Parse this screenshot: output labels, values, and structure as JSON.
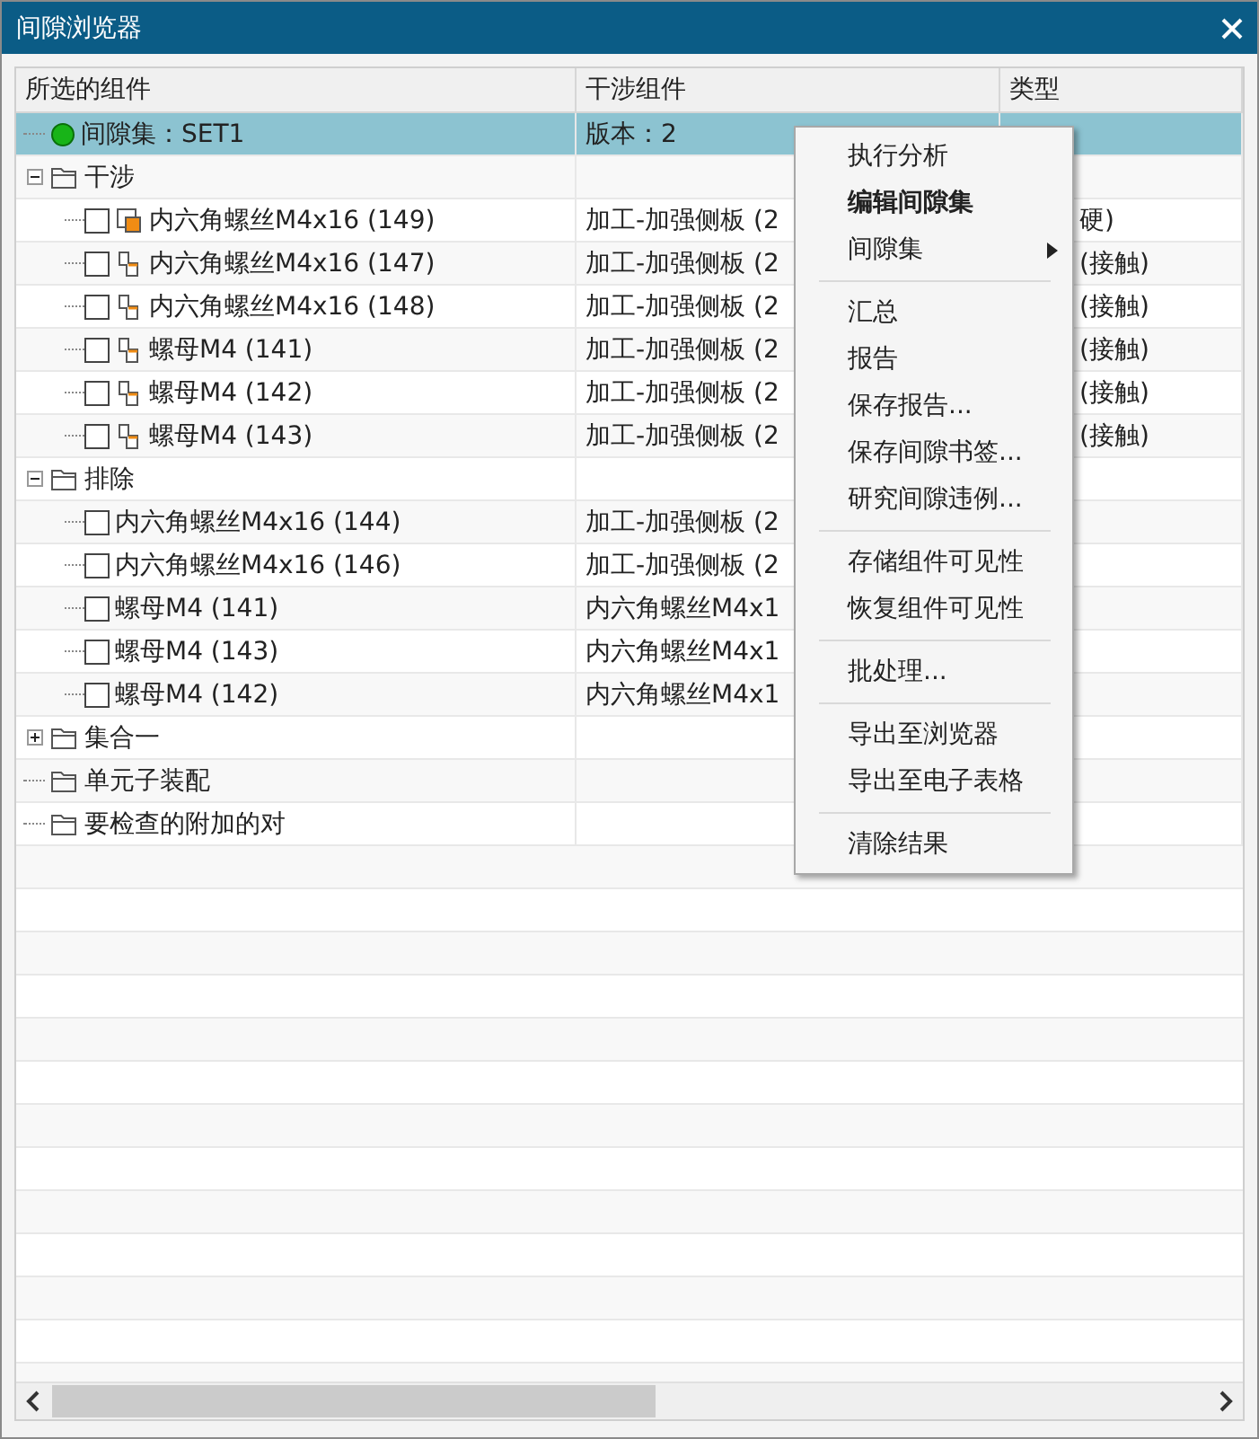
{
  "window": {
    "title": "间隙浏览器"
  },
  "columns": [
    "所选的组件",
    "干涉组件",
    "类型"
  ],
  "set": {
    "label": "间隙集：SET1",
    "interference": "版本：2",
    "selected": true
  },
  "groups": [
    {
      "label": "干涉",
      "expanded": true,
      "items": [
        {
          "label": "内六角螺丝M4x16 (149)",
          "kind": "part-active",
          "checked": false,
          "interference": "加工-加强侧板 (2",
          "type": "硬)"
        },
        {
          "label": "内六角螺丝M4x16 (147)",
          "kind": "part",
          "checked": false,
          "interference": "加工-加强侧板 (2",
          "type": "(接触)"
        },
        {
          "label": "内六角螺丝M4x16 (148)",
          "kind": "part",
          "checked": false,
          "interference": "加工-加强侧板 (2",
          "type": "(接触)"
        },
        {
          "label": "螺母M4 (141)",
          "kind": "part",
          "checked": false,
          "interference": "加工-加强侧板 (2",
          "type": "(接触)"
        },
        {
          "label": "螺母M4 (142)",
          "kind": "part",
          "checked": false,
          "interference": "加工-加强侧板 (2",
          "type": "(接触)"
        },
        {
          "label": "螺母M4 (143)",
          "kind": "part",
          "checked": false,
          "interference": "加工-加强侧板 (2",
          "type": "(接触)"
        }
      ]
    },
    {
      "label": "排除",
      "expanded": true,
      "items": [
        {
          "label": "内六角螺丝M4x16 (144)",
          "kind": "plain",
          "checked": false,
          "interference": "加工-加强侧板 (2"
        },
        {
          "label": "内六角螺丝M4x16 (146)",
          "kind": "plain",
          "checked": false,
          "interference": "加工-加强侧板 (2"
        },
        {
          "label": "螺母M4 (141)",
          "kind": "plain",
          "checked": false,
          "interference": "内六角螺丝M4x1"
        },
        {
          "label": "螺母M4 (143)",
          "kind": "plain",
          "checked": false,
          "interference": "内六角螺丝M4x1"
        },
        {
          "label": "螺母M4 (142)",
          "kind": "plain",
          "checked": false,
          "interference": "内六角螺丝M4x1"
        }
      ]
    },
    {
      "label": "集合一",
      "expanded": false
    },
    {
      "label": "单元子装配"
    },
    {
      "label": "要检查的附加的对"
    }
  ],
  "menu": {
    "groups": [
      [
        {
          "label": "执行分析",
          "default": false
        },
        {
          "label": "编辑间隙集",
          "default": true
        },
        {
          "label": "间隙集",
          "default": false,
          "submenu": true
        }
      ],
      [
        {
          "label": "汇总",
          "default": false
        },
        {
          "label": "报告",
          "default": false
        },
        {
          "label": "保存报告...",
          "default": false
        },
        {
          "label": "保存间隙书签...",
          "default": false
        },
        {
          "label": "研究间隙违例...",
          "default": false
        }
      ],
      [
        {
          "label": "存储组件可见性",
          "default": false
        },
        {
          "label": "恢复组件可见性",
          "default": false
        }
      ],
      [
        {
          "label": "批处理...",
          "default": false
        }
      ],
      [
        {
          "label": "导出至浏览器",
          "default": false
        },
        {
          "label": "导出至电子表格",
          "default": false
        }
      ],
      [
        {
          "label": "清除结果",
          "default": false
        }
      ]
    ]
  }
}
